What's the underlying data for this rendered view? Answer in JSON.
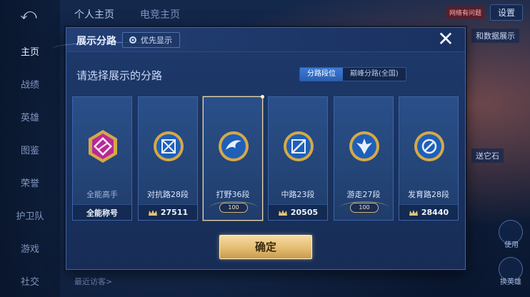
{
  "background": {
    "nav": {
      "items": [
        {
          "label": "主页",
          "active": true
        },
        {
          "label": "战绩",
          "active": false
        },
        {
          "label": "英雄",
          "active": false
        },
        {
          "label": "图鉴",
          "active": false
        },
        {
          "label": "荣誉",
          "active": false
        },
        {
          "label": "护卫队",
          "active": false
        },
        {
          "label": "游戏",
          "active": false
        },
        {
          "label": "社交",
          "active": false
        }
      ]
    },
    "top_tabs": [
      "个人主页",
      "电竞主页"
    ],
    "settings_label": "设置",
    "net_badge": "网络有问题",
    "side_texts": [
      "和数据展示",
      "送它石"
    ],
    "bottom_left": "最近访客>",
    "bottom_right": [
      "使用",
      "换英雄"
    ]
  },
  "modal": {
    "title": "展示分路",
    "priority_label": "优先显示",
    "prompt": "请选择展示的分路",
    "toggle": [
      {
        "label": "分路段位",
        "active": true
      },
      {
        "label": "巅峰分路(全国)",
        "active": false
      }
    ],
    "cards": [
      {
        "label": "全能高手",
        "foot": "全能称号",
        "foot_icon": false,
        "badge": null,
        "selected": false,
        "emblem_color": "#c2309a"
      },
      {
        "label": "对抗路28段",
        "foot": "27511",
        "foot_icon": true,
        "badge": null,
        "selected": false,
        "emblem_color": "#2a74d4"
      },
      {
        "label": "打野36段",
        "foot": null,
        "foot_icon": false,
        "badge": "100",
        "selected": true,
        "emblem_color": "#2a74d4"
      },
      {
        "label": "中路23段",
        "foot": "20505",
        "foot_icon": true,
        "badge": null,
        "selected": false,
        "emblem_color": "#2a74d4"
      },
      {
        "label": "游走27段",
        "foot": null,
        "foot_icon": false,
        "badge": "100",
        "selected": false,
        "emblem_color": "#2a74d4"
      },
      {
        "label": "发育路28段",
        "foot": "28440",
        "foot_icon": true,
        "badge": null,
        "selected": false,
        "emblem_color": "#2a74d4"
      }
    ],
    "confirm_label": "确定",
    "colors": {
      "accent_gold": "#e4bd72",
      "accent_blue": "#3d7bd6"
    }
  }
}
